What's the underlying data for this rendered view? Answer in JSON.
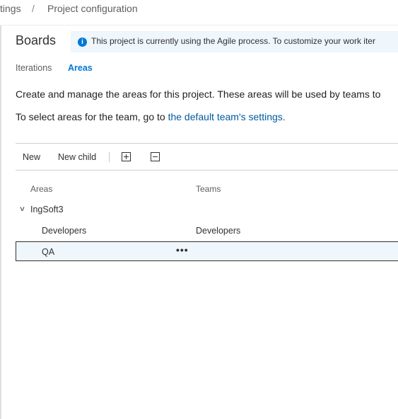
{
  "breadcrumb": {
    "previous": "tings",
    "separator": "/",
    "current": "Project configuration"
  },
  "page": {
    "title": "Boards"
  },
  "banner": {
    "icon": "info-icon",
    "icon_glyph": "i",
    "text": "This project is currently using the Agile process. To customize your work iter"
  },
  "tabs": [
    {
      "label": "Iterations",
      "selected": false
    },
    {
      "label": "Areas",
      "selected": true
    }
  ],
  "description": {
    "line1": "Create and manage the areas for this project. These areas will be used by teams to",
    "line2_prefix": "To select areas for the team, go to ",
    "line2_link": "the default team's settings."
  },
  "toolbar": {
    "new_label": "New",
    "new_child_label": "New child",
    "expand_icon": "expand-all-icon",
    "collapse_icon": "collapse-all-icon"
  },
  "table": {
    "columns": [
      "Areas",
      "Teams"
    ],
    "root": {
      "name": "IngSoft3",
      "expanded": true
    },
    "rows": [
      {
        "area": "Developers",
        "team": "Developers",
        "selected": false
      },
      {
        "area": "QA",
        "team": "",
        "selected": true
      }
    ],
    "more_label": "•••"
  },
  "colors": {
    "accent": "#0078d4",
    "link": "#005a9e",
    "banner_bg": "#eff6fc"
  }
}
